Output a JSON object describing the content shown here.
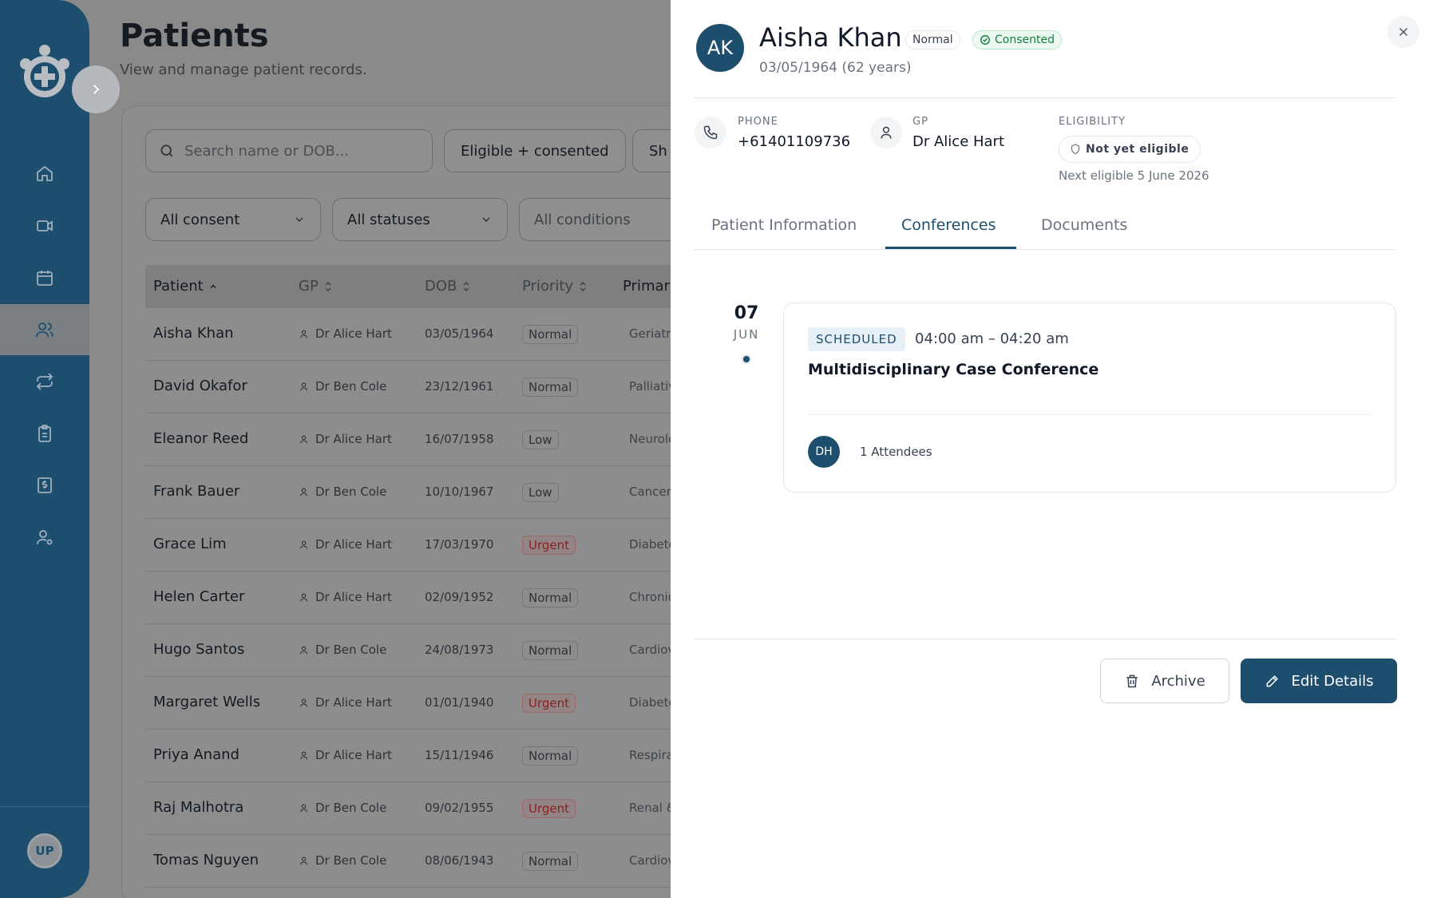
{
  "main": {
    "title": "Patients",
    "subtitle": "View and manage patient records.",
    "search": {
      "placeholder": "Search name or DOB..."
    },
    "filter_buttons": [
      "Eligible + consented",
      "Sh"
    ],
    "selects": [
      "All consent",
      "All statuses",
      "All conditions"
    ],
    "table": {
      "columns": [
        "Patient",
        "GP",
        "DOB",
        "Priority",
        "Primar"
      ],
      "rows": [
        {
          "name": "Aisha Khan",
          "gp": "Dr Alice Hart",
          "dob": "03/05/1964",
          "priority": "Normal",
          "condition": "Geriatri"
        },
        {
          "name": "David Okafor",
          "gp": "Dr Ben Cole",
          "dob": "23/12/1961",
          "priority": "Normal",
          "condition": "Palliativ"
        },
        {
          "name": "Eleanor Reed",
          "gp": "Dr Alice Hart",
          "dob": "16/07/1958",
          "priority": "Low",
          "condition": "Neurolo"
        },
        {
          "name": "Frank Bauer",
          "gp": "Dr Ben Cole",
          "dob": "10/10/1967",
          "priority": "Low",
          "condition": "Cancer"
        },
        {
          "name": "Grace Lim",
          "gp": "Dr Alice Hart",
          "dob": "17/03/1970",
          "priority": "Urgent",
          "condition": "Diabete"
        },
        {
          "name": "Helen Carter",
          "gp": "Dr Alice Hart",
          "dob": "02/09/1952",
          "priority": "Normal",
          "condition": "Chronic"
        },
        {
          "name": "Hugo Santos",
          "gp": "Dr Ben Cole",
          "dob": "24/08/1973",
          "priority": "Normal",
          "condition": "Cardiov"
        },
        {
          "name": "Margaret Wells",
          "gp": "Dr Alice Hart",
          "dob": "01/01/1940",
          "priority": "Urgent",
          "condition": "Diabete"
        },
        {
          "name": "Priya Anand",
          "gp": "Dr Alice Hart",
          "dob": "15/11/1946",
          "priority": "Normal",
          "condition": "Respira"
        },
        {
          "name": "Raj Malhotra",
          "gp": "Dr Ben Cole",
          "dob": "09/02/1955",
          "priority": "Urgent",
          "condition": "Renal &"
        },
        {
          "name": "Tomas Nguyen",
          "gp": "Dr Ben Cole",
          "dob": "08/06/1943",
          "priority": "Normal",
          "condition": "Cardiov"
        }
      ]
    }
  },
  "sidebar": {
    "user_initials": "UP",
    "icons": [
      "home-icon",
      "video-icon",
      "calendar-icon",
      "users-icon",
      "repeat-icon",
      "clipboard-icon",
      "billing-icon",
      "user-settings-icon"
    ],
    "active": "users-icon"
  },
  "drawer": {
    "patient": {
      "initials": "AK",
      "name": "Aisha Khan",
      "priority": "Normal",
      "consent": "Consented",
      "dob_age": "03/05/1964 (62 years)"
    },
    "contact": {
      "phone_label": "PHONE",
      "phone": "+61401109736",
      "gp_label": "GP",
      "gp": "Dr Alice Hart",
      "eligibility_label": "ELIGIBILITY",
      "eligibility": "Not yet eligible",
      "next_eligible": "Next eligible 5 June 2026"
    },
    "tabs": [
      "Patient Information",
      "Conferences",
      "Documents"
    ],
    "active_tab": "Conferences",
    "conference": {
      "day": "07",
      "month": "JUN",
      "status": "SCHEDULED",
      "time": "04:00 am – 04:20 am",
      "title": "Multidisciplinary Case Conference",
      "attendee_initials": "DH",
      "attendees": "1 Attendees"
    },
    "actions": {
      "archive": "Archive",
      "edit": "Edit Details"
    }
  },
  "colors": {
    "brand": "#1e4e6e",
    "consent_green": "#15803d",
    "urgent_red": "#8a1f1f"
  }
}
